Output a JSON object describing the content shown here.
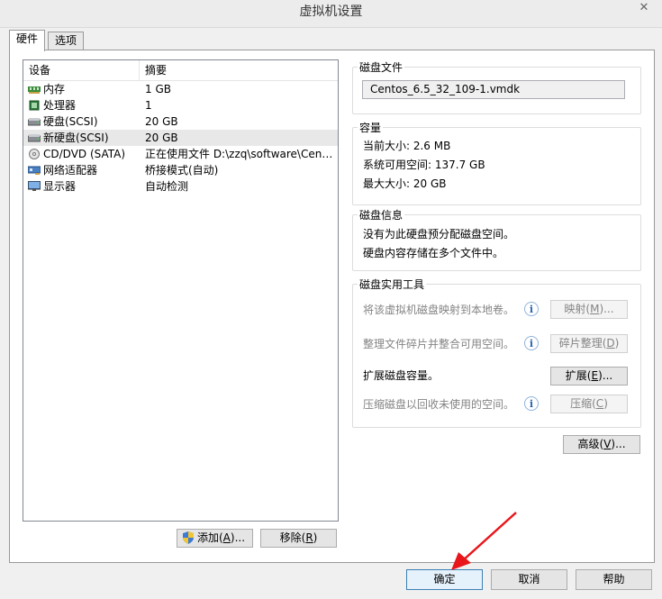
{
  "window": {
    "title": "虚拟机设置",
    "close_glyph": "✕"
  },
  "tabs": [
    {
      "label": "硬件"
    },
    {
      "label": "选项"
    }
  ],
  "device_list": {
    "columns": [
      "设备",
      "摘要"
    ],
    "rows": [
      {
        "name": "内存",
        "summary": "1 GB",
        "icon": "memory-icon"
      },
      {
        "name": "处理器",
        "summary": "1",
        "icon": "processor-icon"
      },
      {
        "name": "硬盘(SCSI)",
        "summary": "20 GB",
        "icon": "hard-disk-icon"
      },
      {
        "name": "新硬盘(SCSI)",
        "summary": "20 GB",
        "icon": "hard-disk-icon",
        "selected": true
      },
      {
        "name": "CD/DVD (SATA)",
        "summary": "正在使用文件 D:\\zzq\\software\\Cent...",
        "icon": "cd-dvd-icon"
      },
      {
        "name": "网络适配器",
        "summary": "桥接模式(自动)",
        "icon": "network-adapter-icon"
      },
      {
        "name": "显示器",
        "summary": "自动检测",
        "icon": "display-icon"
      }
    ]
  },
  "list_buttons": {
    "add": {
      "label": "添加(",
      "key": "A",
      "tail": ")..."
    },
    "remove": {
      "label": "移除(",
      "key": "R",
      "tail": ")"
    }
  },
  "disk_file": {
    "title": "磁盘文件",
    "path": "Centos_6.5_32_109-1.vmdk"
  },
  "capacity": {
    "title": "容量",
    "current_size": "当前大小: 2.6 MB",
    "system_free": "系统可用空间: 137.7 GB",
    "max_size": "最大大小: 20 GB"
  },
  "disk_info": {
    "title": "磁盘信息",
    "line1": "没有为此硬盘预分配磁盘空间。",
    "line2": "硬盘内容存储在多个文件中。"
  },
  "utilities": {
    "title": "磁盘实用工具",
    "map": {
      "text": "将该虚拟机磁盘映射到本地卷。",
      "btn": "映射(",
      "key": "M",
      "tail": ")..."
    },
    "defrag": {
      "text": "整理文件碎片并整合可用空间。",
      "btn": "碎片整理(",
      "key": "D",
      "tail": ")"
    },
    "expand": {
      "text": "扩展磁盘容量。",
      "btn": "扩展(",
      "key": "E",
      "tail": ")..."
    },
    "compact": {
      "text": "压缩磁盘以回收未使用的空间。",
      "btn": "压缩(",
      "key": "C",
      "tail": ")"
    }
  },
  "advanced": {
    "label": "高级(",
    "key": "V",
    "tail": ")..."
  },
  "footer": {
    "ok": "确定",
    "cancel": "取消",
    "help": "帮助"
  },
  "colors": {
    "arrow": "#e8161b",
    "selected_row": "#e8e8e8",
    "primary_border": "#3c7fb1"
  }
}
